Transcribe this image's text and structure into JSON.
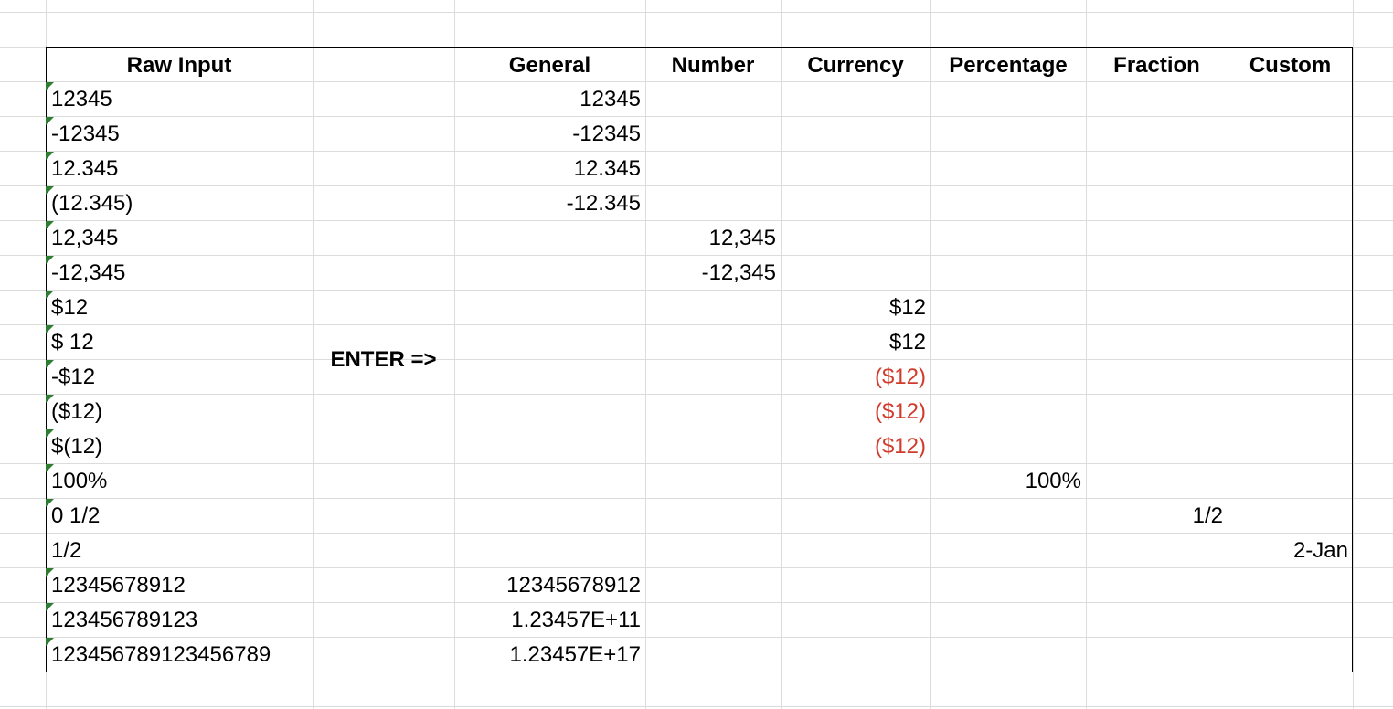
{
  "headers": {
    "raw_input": "Raw Input",
    "general": "General",
    "number": "Number",
    "currency": "Currency",
    "percentage": "Percentage",
    "fraction": "Fraction",
    "custom": "Custom"
  },
  "enter_label": "ENTER =>",
  "indicator_color": "#2e7d32",
  "negative_color": "#d13b2b",
  "rows": [
    {
      "raw": "12345",
      "text_flag": true,
      "col": "general",
      "value": "12345"
    },
    {
      "raw": "-12345",
      "text_flag": true,
      "col": "general",
      "value": "-12345"
    },
    {
      "raw": "12.345",
      "text_flag": true,
      "col": "general",
      "value": "12.345"
    },
    {
      "raw": "(12.345)",
      "text_flag": true,
      "col": "general",
      "value": "-12.345"
    },
    {
      "raw": "12,345",
      "text_flag": true,
      "col": "number",
      "value": "12,345"
    },
    {
      "raw": "-12,345",
      "text_flag": true,
      "col": "number",
      "value": "-12,345"
    },
    {
      "raw": "$12",
      "text_flag": true,
      "col": "currency",
      "value": "$12"
    },
    {
      "raw": "$ 12",
      "text_flag": true,
      "col": "currency",
      "value": "$12"
    },
    {
      "raw": "-$12",
      "text_flag": true,
      "col": "currency",
      "value": "($12)",
      "negative": true
    },
    {
      "raw": "($12)",
      "text_flag": true,
      "col": "currency",
      "value": "($12)",
      "negative": true
    },
    {
      "raw": "$(12)",
      "text_flag": true,
      "col": "currency",
      "value": "($12)",
      "negative": true
    },
    {
      "raw": "100%",
      "text_flag": true,
      "col": "percentage",
      "value": "100%"
    },
    {
      "raw": "0 1/2",
      "text_flag": true,
      "col": "fraction",
      "value": "1/2"
    },
    {
      "raw": "1/2",
      "text_flag": false,
      "col": "custom",
      "value": "2-Jan"
    },
    {
      "raw": "12345678912",
      "text_flag": true,
      "col": "general",
      "value": "12345678912"
    },
    {
      "raw": "123456789123",
      "text_flag": true,
      "col": "general",
      "value": "1.23457E+11"
    },
    {
      "raw": "123456789123456789",
      "text_flag": true,
      "col": "general",
      "value": "1.23457E+17"
    }
  ]
}
